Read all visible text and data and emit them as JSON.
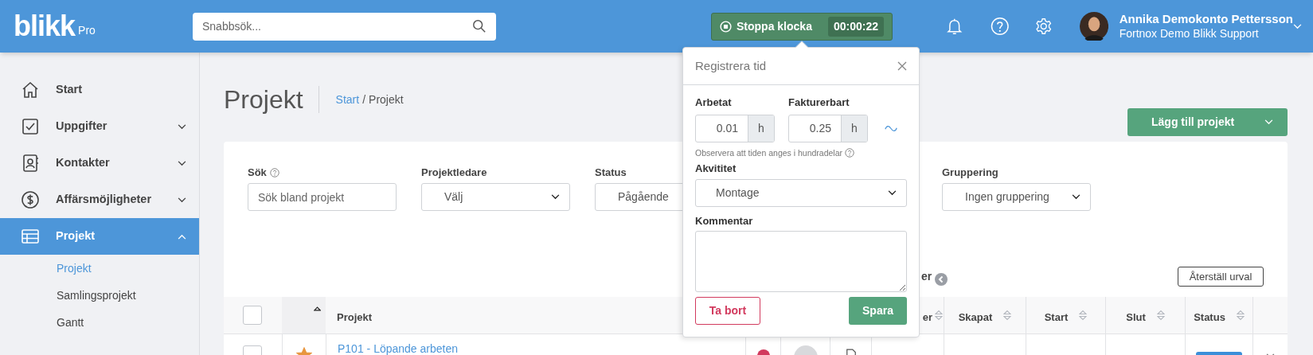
{
  "header": {
    "logo": "blikk",
    "logo_suffix": "Pro",
    "search": {
      "placeholder": "Snabbsök..."
    },
    "timer": {
      "label": "Stoppa klocka",
      "time": "00:00:22",
      "running": true
    },
    "user": {
      "name": "Annika Demokonto Pettersson",
      "company": "Fortnox Demo Blikk Support"
    }
  },
  "sidebar": {
    "items": [
      {
        "label": "Start",
        "kind": "link",
        "selected": false
      },
      {
        "label": "Uppgifter",
        "kind": "group",
        "selected": false,
        "expanded": false
      },
      {
        "label": "Kontakter",
        "kind": "group",
        "selected": false,
        "expanded": false
      },
      {
        "label": "Affärsmöjligheter",
        "kind": "group",
        "selected": false,
        "expanded": false
      },
      {
        "label": "Projekt",
        "kind": "group",
        "selected": true,
        "expanded": true,
        "children": [
          {
            "label": "Projekt",
            "selected": true
          },
          {
            "label": "Samlingsprojekt",
            "selected": false
          },
          {
            "label": "Gantt",
            "selected": false
          }
        ]
      }
    ]
  },
  "page": {
    "title": "Projekt",
    "breadcrumb": [
      {
        "label": "Start",
        "link": true
      },
      {
        "label": "/",
        "link": false
      },
      {
        "label": "Projekt",
        "link": false
      }
    ],
    "add_button": "Lägg till projekt"
  },
  "filters": [
    {
      "label": "Sök",
      "help": true,
      "kind": "text",
      "placeholder": "Sök bland projekt"
    },
    {
      "label": "Projektledare",
      "help": false,
      "kind": "select",
      "value": "Välj"
    },
    {
      "label": "Status",
      "help": false,
      "kind": "field",
      "value": "Pågående"
    },
    {
      "kind": "covered"
    },
    {
      "label": "Gruppering",
      "help": false,
      "kind": "select",
      "value": "Ingen gruppering"
    }
  ],
  "columns_toggle": {
    "label": "er"
  },
  "reset_button": "Återställ urval",
  "table": {
    "columns": [
      {
        "kind": "checkbox",
        "checked": false
      },
      {
        "kind": "sort_indicator"
      },
      {
        "kind": "text",
        "label": "Projekt"
      },
      {
        "kind": "covered"
      },
      {
        "kind": "covered"
      },
      {
        "kind": "covered"
      },
      {
        "kind": "sortable_clipped",
        "label": "er"
      },
      {
        "kind": "sortable",
        "label": "Skapat"
      },
      {
        "kind": "sortable",
        "label": "Start"
      },
      {
        "kind": "sortable",
        "label": "Slut"
      },
      {
        "kind": "sortable",
        "label": "Status"
      },
      {
        "kind": "blank"
      }
    ],
    "rows": [
      {
        "checked": false,
        "starred": true,
        "project": "P101 - Löpande arbeten"
      }
    ]
  },
  "popover": {
    "title": "Registrera tid",
    "worked": {
      "label": "Arbetat",
      "value": "0.01",
      "unit": "h"
    },
    "billable": {
      "label": "Fakturerbart",
      "value": "0.25",
      "unit": "h"
    },
    "note": "Observera att tiden anges i hundradelar",
    "activity": {
      "label": "Akvititet",
      "value": "Montage"
    },
    "comment": {
      "label": "Kommentar"
    },
    "delete_button": "Ta bort",
    "save_button": "Spara"
  }
}
